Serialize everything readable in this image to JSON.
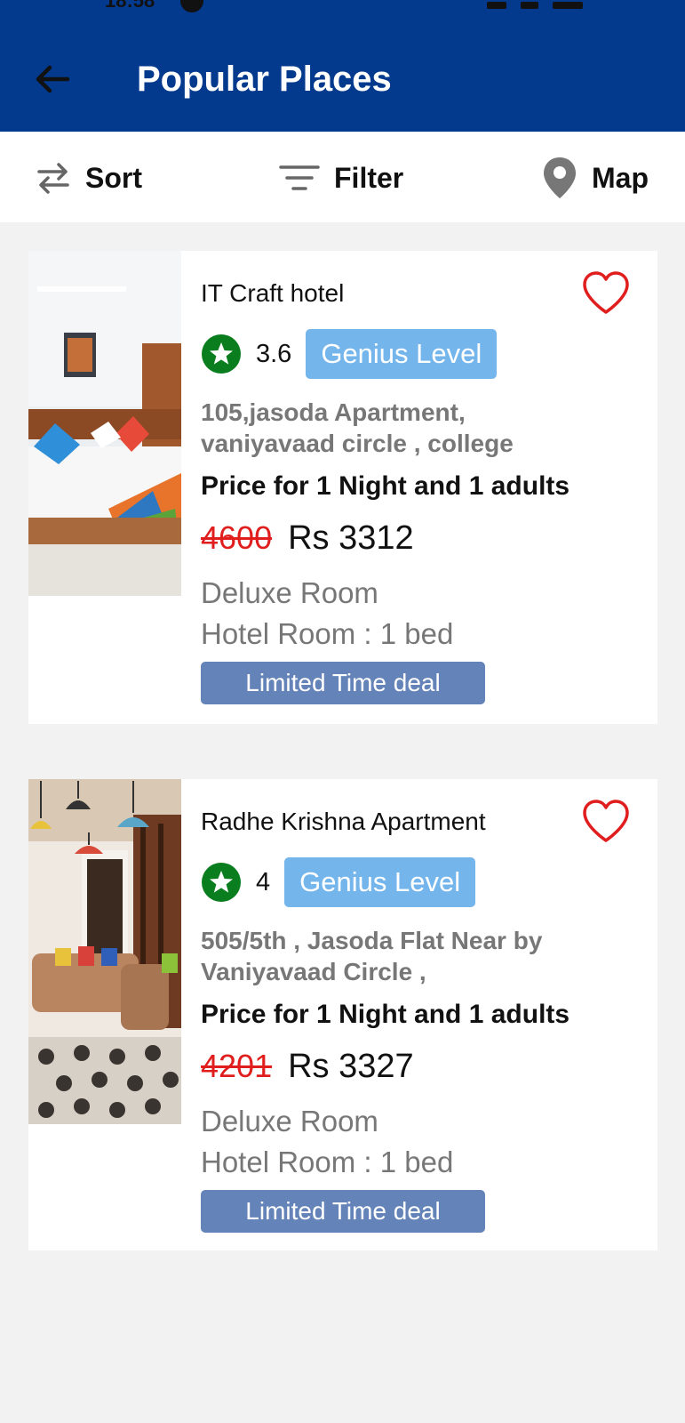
{
  "status_bar": {
    "time": "18:58"
  },
  "header": {
    "title": "Popular Places"
  },
  "toolbar": {
    "sort_label": "Sort",
    "filter_label": "Filter",
    "map_label": "Map"
  },
  "colors": {
    "primary": "#033a8e",
    "genius_badge": "#74b5ec",
    "deal_badge": "#6483b8",
    "rating_green": "#0a7d1e",
    "favorite_red": "#e01e1e",
    "strike_price": "#e01e1e"
  },
  "hotels": [
    {
      "name": "IT Craft hotel",
      "rating": "3.6",
      "badge": "Genius Level",
      "address": "105,jasoda Apartment, vaniyavaad circle , college",
      "price_for": "Price for 1 Night and 1 adults",
      "old_price": "4600",
      "new_price": "Rs 3312",
      "room_type": "Deluxe Room",
      "room_beds": "Hotel Room : 1 bed",
      "deal": "Limited Time deal"
    },
    {
      "name": "Radhe Krishna Apartment",
      "rating": "4",
      "badge": "Genius Level",
      "address": "505/5th , Jasoda Flat Near by Vaniyavaad Circle ,",
      "price_for": "Price for 1 Night and 1 adults",
      "old_price": "4201",
      "new_price": "Rs 3327",
      "room_type": "Deluxe Room",
      "room_beds": "Hotel Room : 1 bed",
      "deal": "Limited Time deal"
    }
  ]
}
